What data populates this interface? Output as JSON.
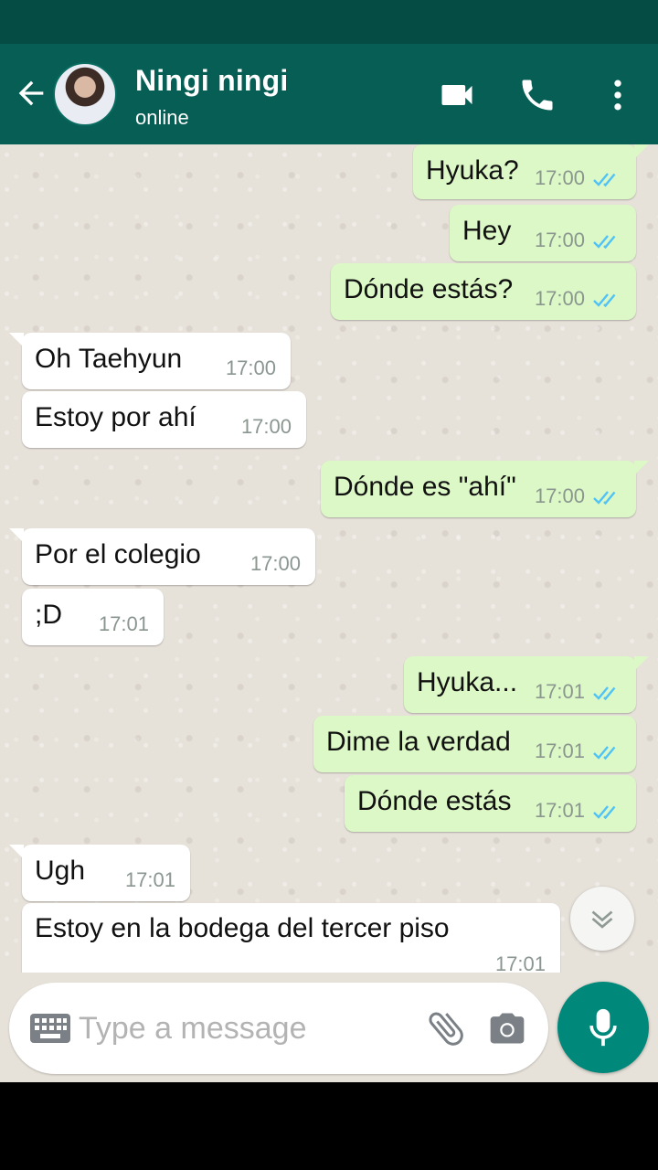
{
  "header": {
    "contact_name": "Ningi ningi",
    "contact_status": "online",
    "icons": [
      "arrow-back-icon",
      "video-call-icon",
      "phone-icon",
      "more-vert-icon"
    ]
  },
  "messages": [
    {
      "direction": "out",
      "text": "Hyuka?",
      "time": "17:00",
      "read": true
    },
    {
      "direction": "out",
      "text": "Hey",
      "time": "17:00",
      "read": true
    },
    {
      "direction": "out",
      "text": "Dónde estás?",
      "time": "17:00",
      "read": true
    },
    {
      "direction": "in",
      "text": "Oh Taehyun",
      "time": "17:00"
    },
    {
      "direction": "in",
      "text": "Estoy por ahí",
      "time": "17:00"
    },
    {
      "direction": "out",
      "text": "Dónde es \"ahí\"",
      "time": "17:00",
      "read": true
    },
    {
      "direction": "in",
      "text": "Por el colegio",
      "time": "17:00"
    },
    {
      "direction": "in",
      "text": ";D",
      "time": "17:01"
    },
    {
      "direction": "out",
      "text": "Hyuka...",
      "time": "17:01",
      "read": true
    },
    {
      "direction": "out",
      "text": "Dime la verdad",
      "time": "17:01",
      "read": true
    },
    {
      "direction": "out",
      "text": "Dónde estás",
      "time": "17:01",
      "read": true
    },
    {
      "direction": "in",
      "text": "Ugh",
      "time": "17:01"
    },
    {
      "direction": "in",
      "text": "Estoy en la bodega del tercer piso",
      "time": "17:01"
    }
  ],
  "composer": {
    "placeholder": "Type a message",
    "value": "",
    "icons": [
      "keyboard-icon",
      "attach-icon",
      "camera-icon",
      "mic-icon"
    ]
  },
  "colors": {
    "header": "#075e54",
    "status_bar": "#054d44",
    "outgoing_bubble": "#dcf8c6",
    "incoming_bubble": "#ffffff",
    "read_ticks": "#4fc3f7",
    "mic_button": "#00897b",
    "chat_background": "#e6e1d9"
  }
}
